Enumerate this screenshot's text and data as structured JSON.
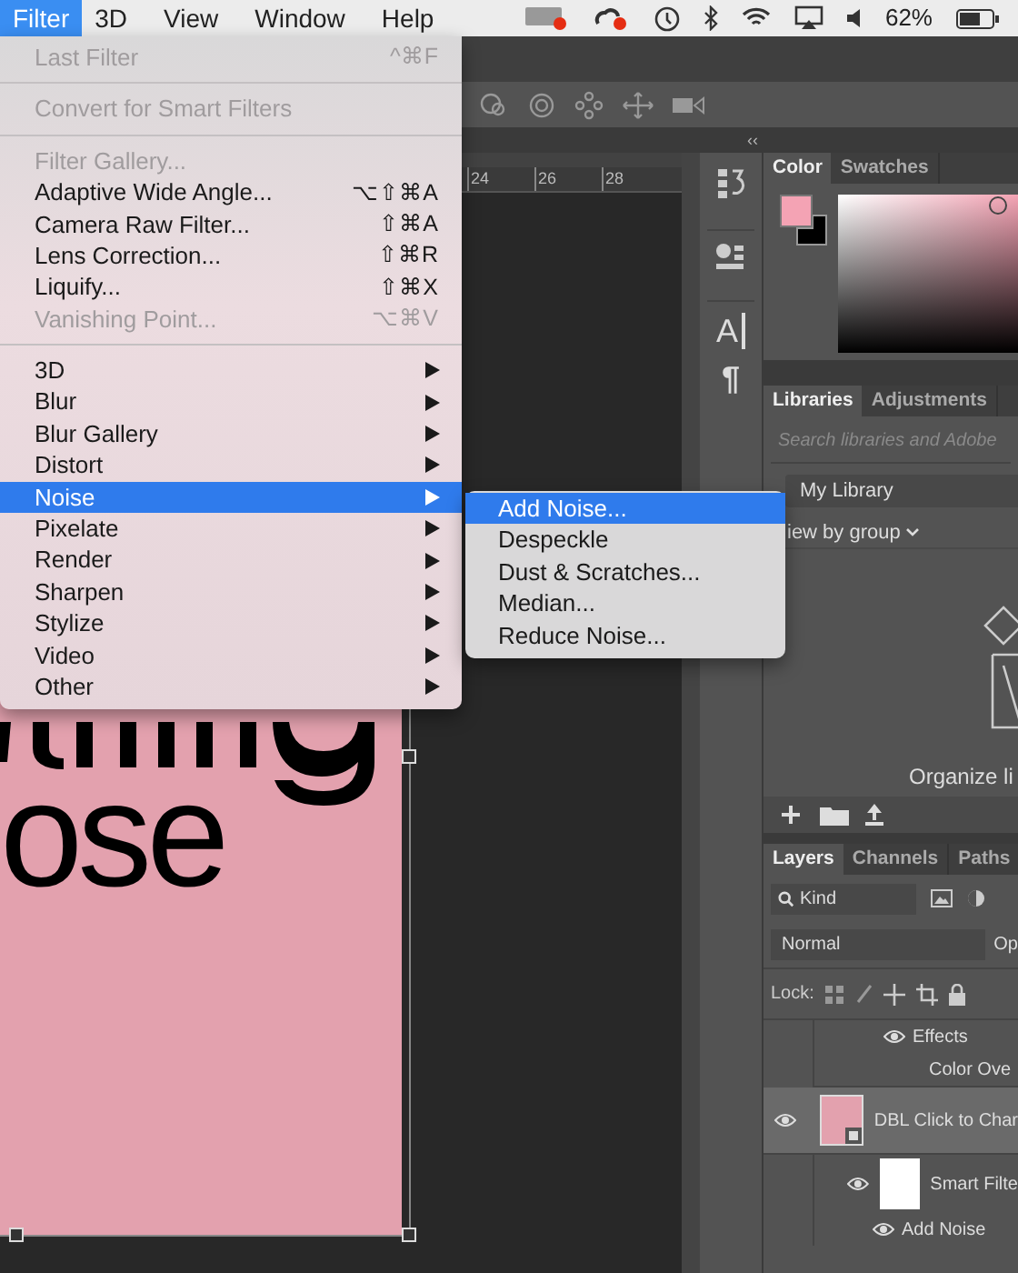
{
  "menu_bar": {
    "items": [
      {
        "label": "Filter",
        "selected": true
      },
      {
        "label": "3D",
        "selected": false
      },
      {
        "label": "View",
        "selected": false
      },
      {
        "label": "Window",
        "selected": false
      },
      {
        "label": "Help",
        "selected": false
      }
    ],
    "battery": "62%"
  },
  "filter_menu": {
    "items": [
      {
        "kind": "item",
        "label": "Last Filter",
        "shortcut": "^⌘F",
        "disabled": true,
        "submenu": false,
        "selected": false
      },
      {
        "kind": "separator"
      },
      {
        "kind": "item",
        "label": "Convert for Smart Filters",
        "disabled": true,
        "submenu": false,
        "selected": false
      },
      {
        "kind": "separator"
      },
      {
        "kind": "item",
        "label": "Filter Gallery...",
        "disabled": true,
        "submenu": false,
        "selected": false
      },
      {
        "kind": "item",
        "label": "Adaptive Wide Angle...",
        "shortcut": "⌥⇧⌘A",
        "disabled": false,
        "submenu": false,
        "selected": false
      },
      {
        "kind": "item",
        "label": "Camera Raw Filter...",
        "shortcut": "⇧⌘A",
        "disabled": false,
        "submenu": false,
        "selected": false
      },
      {
        "kind": "item",
        "label": "Lens Correction...",
        "shortcut": "⇧⌘R",
        "disabled": false,
        "submenu": false,
        "selected": false
      },
      {
        "kind": "item",
        "label": "Liquify...",
        "shortcut": "⇧⌘X",
        "disabled": false,
        "submenu": false,
        "selected": false
      },
      {
        "kind": "item",
        "label": "Vanishing Point...",
        "shortcut": "⌥⌘V",
        "disabled": true,
        "submenu": false,
        "selected": false
      },
      {
        "kind": "separator"
      },
      {
        "kind": "item",
        "label": "3D",
        "disabled": false,
        "submenu": true,
        "selected": false
      },
      {
        "kind": "item",
        "label": "Blur",
        "disabled": false,
        "submenu": true,
        "selected": false
      },
      {
        "kind": "item",
        "label": "Blur Gallery",
        "disabled": false,
        "submenu": true,
        "selected": false
      },
      {
        "kind": "item",
        "label": "Distort",
        "disabled": false,
        "submenu": true,
        "selected": false
      },
      {
        "kind": "item",
        "label": "Noise",
        "disabled": false,
        "submenu": true,
        "selected": true
      },
      {
        "kind": "item",
        "label": "Pixelate",
        "disabled": false,
        "submenu": true,
        "selected": false
      },
      {
        "kind": "item",
        "label": "Render",
        "disabled": false,
        "submenu": true,
        "selected": false
      },
      {
        "kind": "item",
        "label": "Sharpen",
        "disabled": false,
        "submenu": true,
        "selected": false
      },
      {
        "kind": "item",
        "label": "Stylize",
        "disabled": false,
        "submenu": true,
        "selected": false
      },
      {
        "kind": "item",
        "label": "Video",
        "disabled": false,
        "submenu": true,
        "selected": false
      },
      {
        "kind": "item",
        "label": "Other",
        "disabled": false,
        "submenu": true,
        "selected": false
      }
    ]
  },
  "noise_submenu": {
    "items": [
      {
        "label": "Add Noise...",
        "selected": true
      },
      {
        "label": "Despeckle",
        "selected": false
      },
      {
        "label": "Dust & Scratches...",
        "selected": false
      },
      {
        "label": "Median...",
        "selected": false
      },
      {
        "label": "Reduce Noise...",
        "selected": false
      }
    ]
  },
  "ruler": {
    "labels": [
      "24",
      "26",
      "28"
    ]
  },
  "canvas": {
    "text_lines": [
      "ose"
    ]
  },
  "dock": {
    "glyphs": [
      "A",
      "¶"
    ]
  },
  "collapse_glyph": "‹‹",
  "color_panel": {
    "tabs": [
      {
        "label": "Color",
        "selected": true
      },
      {
        "label": "Swatches",
        "selected": false
      }
    ]
  },
  "libraries_panel": {
    "tabs": [
      {
        "label": "Libraries",
        "selected": true
      },
      {
        "label": "Adjustments",
        "selected": false
      }
    ],
    "search": {
      "placeholder": "Search libraries and Adobe"
    },
    "library": "My Library",
    "view": "iew by group",
    "message": "Organize li"
  },
  "layers_panel": {
    "tabs": [
      {
        "label": "Layers",
        "selected": true
      },
      {
        "label": "Channels",
        "selected": false
      },
      {
        "label": "Paths",
        "selected": false
      }
    ],
    "filter": "Kind",
    "blend_mode": "Normal",
    "opacity_label": "Op",
    "lock_label": "Lock:",
    "layers": [
      {
        "kind": "effects",
        "label": "Effects",
        "visible": true,
        "selected": false
      },
      {
        "kind": "effect",
        "label": "Color Ove",
        "selected": false
      },
      {
        "kind": "layer",
        "label": "DBL Click to Char",
        "visible": true,
        "selected": true
      },
      {
        "kind": "smart-filters",
        "label": "Smart Filte",
        "visible": true,
        "selected": false
      },
      {
        "kind": "filter",
        "label": "Add Noise",
        "visible": true,
        "selected": false
      }
    ]
  }
}
